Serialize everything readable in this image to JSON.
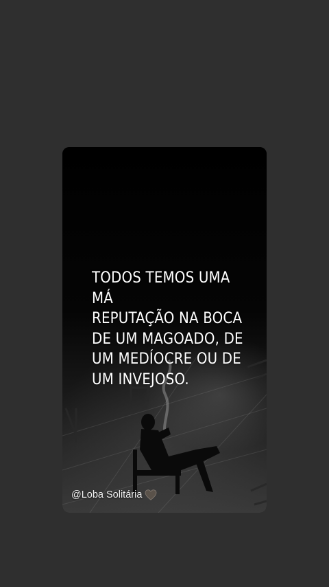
{
  "post": {
    "quote": "Todos temos uma má\nreputação na boca\nde um magoado, de\num medíocre ou de\num invejoso.",
    "author": "@Loba Solitária",
    "author_icon": "heart-icon"
  },
  "colors": {
    "background": "#2f2f2f",
    "card": "#050505",
    "text": "#ffffff"
  }
}
